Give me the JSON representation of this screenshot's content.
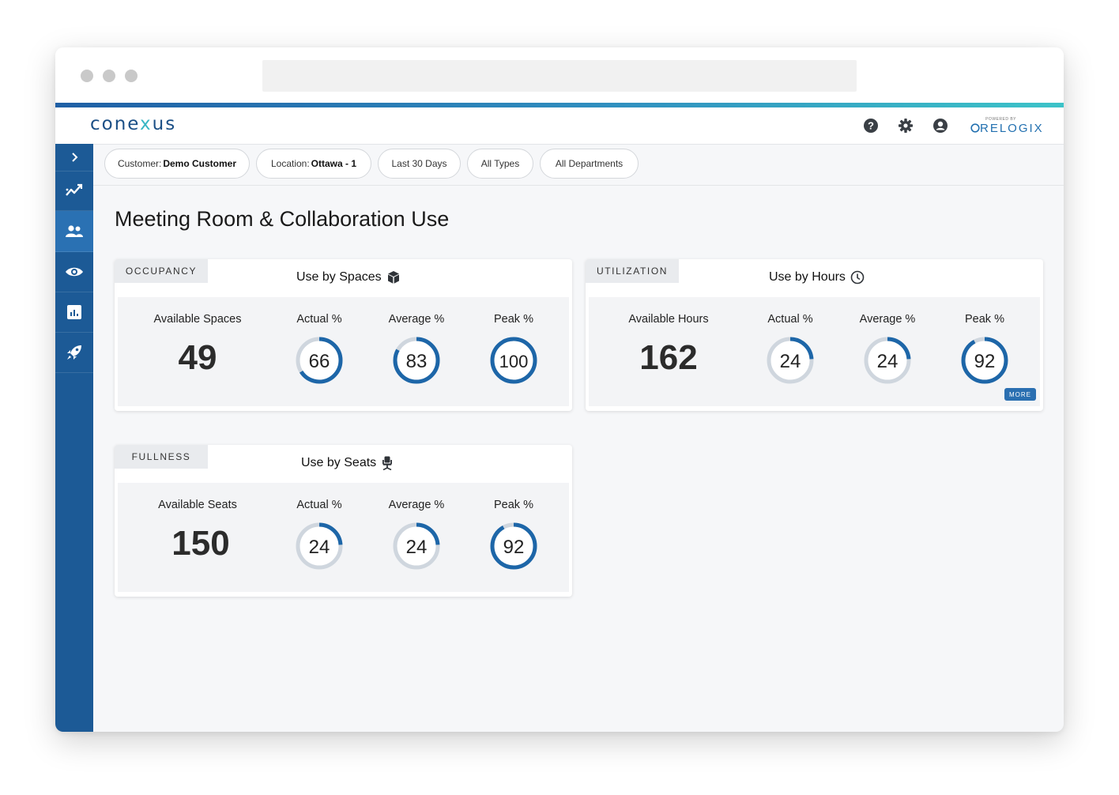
{
  "brand": {
    "app_logo_prefix": "cone",
    "app_logo_accent": "x",
    "app_logo_suffix": "us",
    "powered_by": "POWERED BY",
    "relogix": "RELOGIX"
  },
  "colors": {
    "primary": "#1c5a96",
    "ring": "#1d66a8",
    "track": "#cfd6de"
  },
  "sidebar": {
    "items": [
      "expand-icon",
      "trend-icon",
      "people-icon",
      "eye-icon",
      "report-icon",
      "rocket-icon"
    ],
    "active": "people-icon"
  },
  "filters": [
    {
      "prefix": "Customer:",
      "value": "Demo Customer"
    },
    {
      "prefix": "Location:",
      "value": "Ottawa - 1"
    },
    {
      "prefix": "",
      "value": "Last 30 Days"
    },
    {
      "prefix": "",
      "value": "All Types"
    },
    {
      "prefix": "",
      "value": "All Departments"
    }
  ],
  "page": {
    "title": "Meeting Room & Collaboration Use"
  },
  "cards": [
    {
      "tab": "OCCUPANCY",
      "title": "Use by Spaces",
      "icon": "cube-icon",
      "available_label": "Available Spaces",
      "available_value": "49",
      "metrics": [
        {
          "label": "Actual %",
          "value": 66
        },
        {
          "label": "Average %",
          "value": 83
        },
        {
          "label": "Peak %",
          "value": 100
        }
      ]
    },
    {
      "tab": "UTILIZATION",
      "title": "Use by Hours",
      "icon": "clock-icon",
      "available_label": "Available Hours",
      "available_value": "162",
      "metrics": [
        {
          "label": "Actual %",
          "value": 24
        },
        {
          "label": "Average %",
          "value": 24
        },
        {
          "label": "Peak %",
          "value": 92
        }
      ],
      "more_label": "MORE"
    },
    {
      "tab": "FULLNESS",
      "title": "Use by Seats",
      "icon": "chair-icon",
      "available_label": "Available Seats",
      "available_value": "150",
      "metrics": [
        {
          "label": "Actual %",
          "value": 24
        },
        {
          "label": "Average %",
          "value": 24
        },
        {
          "label": "Peak %",
          "value": 92
        }
      ]
    }
  ]
}
